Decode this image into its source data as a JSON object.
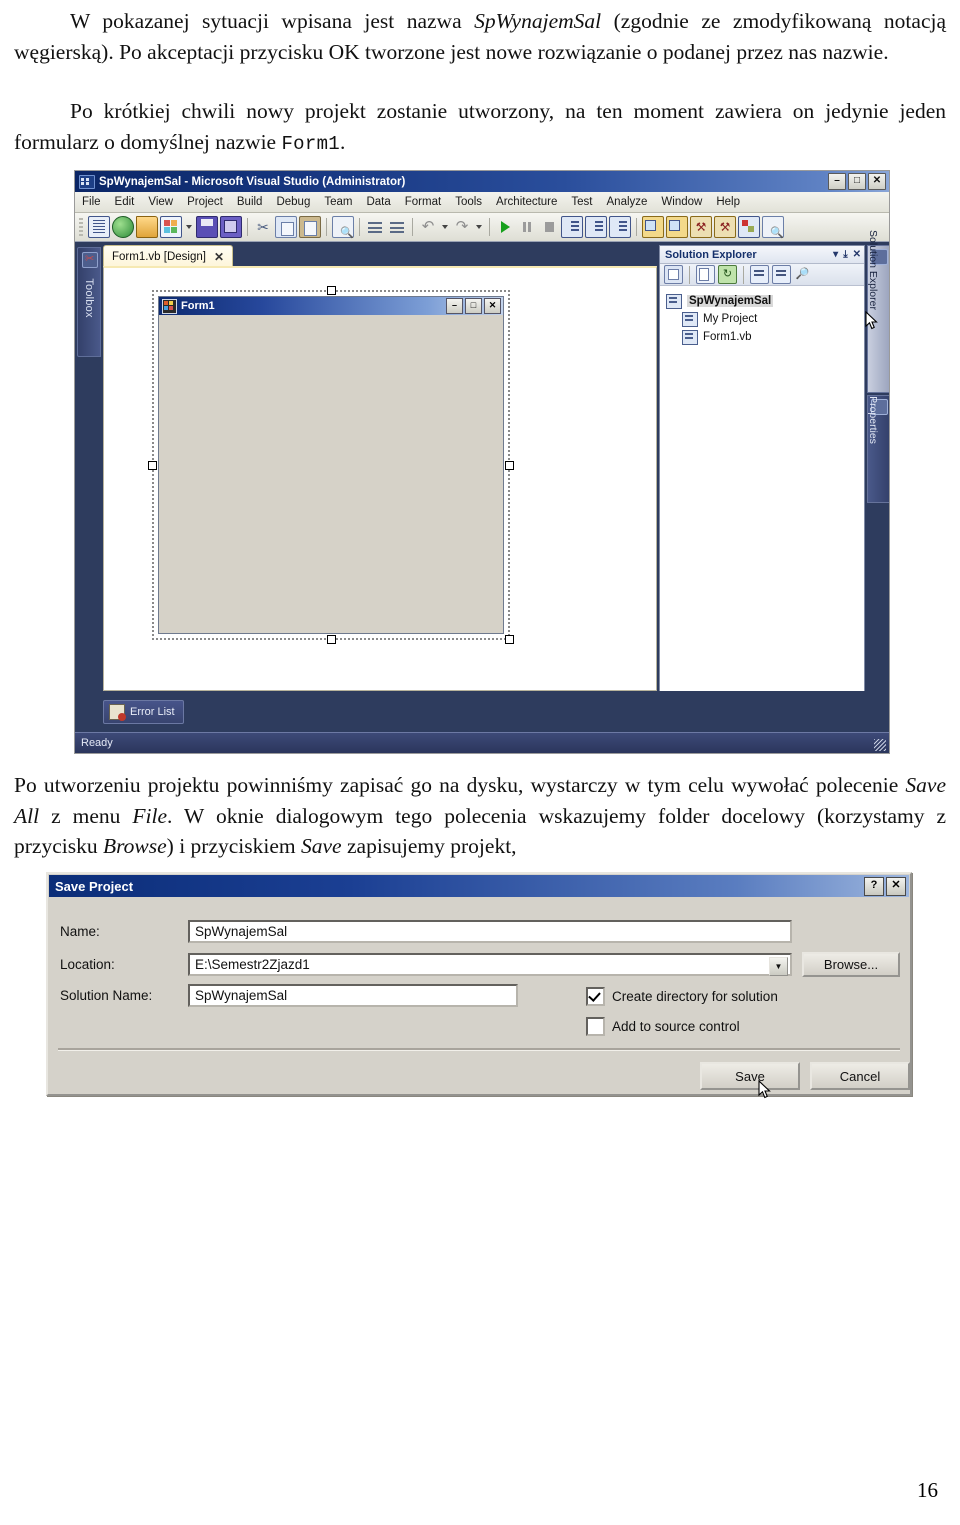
{
  "document": {
    "paragraph1_pre": "W pokazanej sytuacji wpisana jest nazwa ",
    "paragraph1_italic": "SpWynajemSal",
    "paragraph1_post": " (zgodnie ze zmodyfikowaną notacją węgierską). Po akceptacji przycisku OK tworzone jest nowe rozwiązanie o podanej przez nas nazwie.",
    "paragraph2_pre": "Po krótkiej chwili nowy projekt zostanie utworzony, na ten moment zawiera on jedynie jeden formularz o domyślnej nazwie ",
    "paragraph2_mono": "Form1",
    "paragraph2_post": ".",
    "paragraph3_a": "Po utworzeniu projektu powinniśmy zapisać go na dysku, wystarczy w tym celu wywołać polecenie ",
    "paragraph3_i1": "Save All",
    "paragraph3_b": " z menu ",
    "paragraph3_i2": "File",
    "paragraph3_c": ". W oknie dialogowym tego polecenia wskazujemy folder docelowy (korzystamy z przycisku ",
    "paragraph3_i3": "Browse",
    "paragraph3_d": ") i przyciskiem ",
    "paragraph3_i4": "Save",
    "paragraph3_e": " zapisujemy projekt,",
    "page_number": "16"
  },
  "vs": {
    "window_title": "SpWynajemSal - Microsoft Visual Studio (Administrator)",
    "window_icon": "visual-studio-icon",
    "window_buttons": [
      "–",
      "□",
      "✕"
    ],
    "menu": [
      "File",
      "Edit",
      "View",
      "Project",
      "Build",
      "Debug",
      "Team",
      "Data",
      "Format",
      "Tools",
      "Architecture",
      "Test",
      "Analyze",
      "Window",
      "Help"
    ],
    "toolbar_icons": [
      "new-project-icon",
      "new-web-site-icon",
      "open-file-icon",
      "add-new-item-icon",
      "save-icon",
      "save-all-icon",
      "cut-icon",
      "copy-icon",
      "paste-icon",
      "find-icon",
      "comment-icon",
      "uncomment-icon",
      "undo-icon",
      "redo-icon",
      "start-debug-icon",
      "pause-icon",
      "stop-icon",
      "step-into-icon",
      "step-over-icon",
      "step-out-icon",
      "solution-explorer-icon",
      "properties-window-icon",
      "object-browser-icon",
      "toolbox-icon",
      "error-list-icon",
      "navigate-icon"
    ],
    "toolbox_tab": "Toolbox",
    "toolbox_icon": "toolbox-icon",
    "document_tab": "Form1.vb [Design]",
    "document_tab_close": "✕",
    "form": {
      "title": "Form1",
      "icon": "form-designer-icon",
      "buttons": [
        "–",
        "□",
        "✕"
      ]
    },
    "solution_explorer": {
      "title": "Solution Explorer",
      "controls": [
        "▾",
        "⤓",
        "✕"
      ],
      "toolbar_icons": [
        "properties-icon",
        "show-all-files-icon",
        "refresh-icon",
        "view-code-icon",
        "view-designer-icon",
        "object-browser-icon"
      ],
      "tree": [
        {
          "label": "SpWynajemSal",
          "icon": "solution-icon",
          "level": 0,
          "selected": true
        },
        {
          "label": "My Project",
          "icon": "my-project-icon",
          "level": 1,
          "selected": false
        },
        {
          "label": "Form1.vb",
          "icon": "form-file-icon",
          "level": 1,
          "selected": false
        }
      ]
    },
    "right_tabs": [
      {
        "label": "Solution Explorer",
        "icon": "solution-explorer-icon",
        "selected": true
      },
      {
        "label": "Properties",
        "icon": "properties-icon",
        "selected": false
      }
    ],
    "error_list_tab": "Error List",
    "error_list_icon": "error-list-icon",
    "status_text": "Ready"
  },
  "dialog": {
    "title": "Save Project",
    "help_button": "?",
    "close_button": "✕",
    "fields": [
      {
        "label": "Name:",
        "value": "SpWynajemSal"
      },
      {
        "label": "Location:",
        "value": "E:\\Semestr2Zjazd1"
      },
      {
        "label": "Solution Name:",
        "value": "SpWynajemSal"
      }
    ],
    "browse_button": "Browse...",
    "checkboxes": [
      {
        "label": "Create directory for solution",
        "checked": true
      },
      {
        "label": "Add to source control",
        "checked": false
      }
    ],
    "save_button": "Save",
    "cancel_button": "Cancel"
  },
  "colors": {
    "vs_chrome": "#2e3c5e",
    "title_blue": "#0b2666",
    "dialog_face": "#d5d2ca",
    "tab_yellow": "#fdf5d8"
  }
}
